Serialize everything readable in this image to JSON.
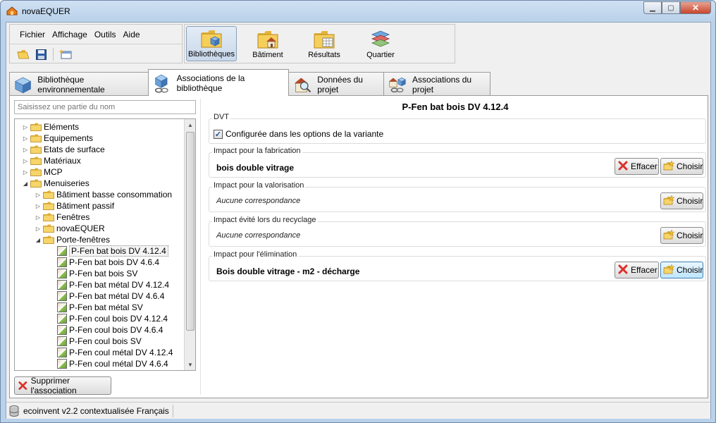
{
  "window": {
    "title": "novaEQUER"
  },
  "menu": [
    {
      "label": "Fichier"
    },
    {
      "label": "Affichage"
    },
    {
      "label": "Outils"
    },
    {
      "label": "Aide"
    }
  ],
  "ribbon": [
    {
      "label": "Bibliothèques",
      "icon": "library-folder-icon",
      "active": true
    },
    {
      "label": "Bâtiment",
      "icon": "building-folder-icon",
      "active": false
    },
    {
      "label": "Résultats",
      "icon": "results-folder-icon",
      "active": false
    },
    {
      "label": "Quartier",
      "icon": "district-map-icon",
      "active": false
    }
  ],
  "tabs": [
    {
      "label": "Bibliothèque environnementale",
      "icon": "cubes-icon"
    },
    {
      "label": "Associations de la bibliothèque",
      "icon": "cubes-link-icon",
      "active": true
    },
    {
      "label": "Données du projet",
      "icon": "house-magnifier-icon"
    },
    {
      "label": "Associations du projet",
      "icon": "house-link-icon"
    }
  ],
  "left": {
    "search_placeholder": "Saisissez une partie du nom",
    "tree": [
      {
        "label": "Eléments",
        "level": 0,
        "expanded": false,
        "type": "folder"
      },
      {
        "label": "Equipements",
        "level": 0,
        "expanded": false,
        "type": "folder"
      },
      {
        "label": "Etats de surface",
        "level": 0,
        "expanded": false,
        "type": "folder"
      },
      {
        "label": "Matériaux",
        "level": 0,
        "expanded": false,
        "type": "folder"
      },
      {
        "label": "MCP",
        "level": 0,
        "expanded": false,
        "type": "folder"
      },
      {
        "label": "Menuiseries",
        "level": 0,
        "expanded": true,
        "type": "folder"
      },
      {
        "label": "Bâtiment basse consommation",
        "level": 1,
        "expanded": false,
        "type": "folder"
      },
      {
        "label": "Bâtiment passif",
        "level": 1,
        "expanded": false,
        "type": "folder"
      },
      {
        "label": "Fenêtres",
        "level": 1,
        "expanded": false,
        "type": "folder"
      },
      {
        "label": "novaEQUER",
        "level": 1,
        "expanded": false,
        "type": "folder"
      },
      {
        "label": "Porte-fenêtres",
        "level": 1,
        "expanded": true,
        "type": "folder"
      },
      {
        "label": "P-Fen bat bois DV 4.12.4",
        "level": 2,
        "type": "item",
        "selected": true
      },
      {
        "label": "P-Fen bat bois DV 4.6.4",
        "level": 2,
        "type": "item"
      },
      {
        "label": "P-Fen bat bois SV",
        "level": 2,
        "type": "item"
      },
      {
        "label": "P-Fen bat métal DV 4.12.4",
        "level": 2,
        "type": "item"
      },
      {
        "label": "P-Fen bat métal DV 4.6.4",
        "level": 2,
        "type": "item"
      },
      {
        "label": "P-Fen bat métal SV",
        "level": 2,
        "type": "item"
      },
      {
        "label": "P-Fen coul bois DV 4.12.4",
        "level": 2,
        "type": "item"
      },
      {
        "label": "P-Fen coul bois DV 4.6.4",
        "level": 2,
        "type": "item"
      },
      {
        "label": "P-Fen coul bois SV",
        "level": 2,
        "type": "item"
      },
      {
        "label": "P-Fen coul métal DV 4.12.4",
        "level": 2,
        "type": "item"
      },
      {
        "label": "P-Fen coul métal DV 4.6.4",
        "level": 2,
        "type": "item"
      }
    ],
    "delete_button": "Supprimer l'association"
  },
  "right": {
    "title": "P-Fen bat bois DV 4.12.4",
    "dvt": {
      "label": "DVT",
      "checkbox_label": "Configurée dans les options de la variante",
      "checked": true
    },
    "groups": [
      {
        "label": "Impact pour la fabrication",
        "value": "bois double vitrage",
        "matched": true,
        "has_clear": true
      },
      {
        "label": "Impact pour la valorisation",
        "value": "Aucune correspondance",
        "matched": false,
        "has_clear": false
      },
      {
        "label": "Impact évité lors du recyclage",
        "value": "Aucune correspondance",
        "matched": false,
        "has_clear": false
      },
      {
        "label": "Impact pour l'élimination",
        "value": "Bois double vitrage - m2 - décharge",
        "matched": true,
        "has_clear": true
      }
    ],
    "clear_label": "Effacer",
    "choose_label": "Choisir"
  },
  "status": {
    "text": "ecoinvent v2.2 contextualisée Français"
  },
  "colors": {
    "title_bar": "#b9d1ea",
    "client_bg": "#f0f0f0",
    "folder": "#f2c94c",
    "active_button": "#c9d8ea",
    "clear_icon": "#d9322b"
  }
}
